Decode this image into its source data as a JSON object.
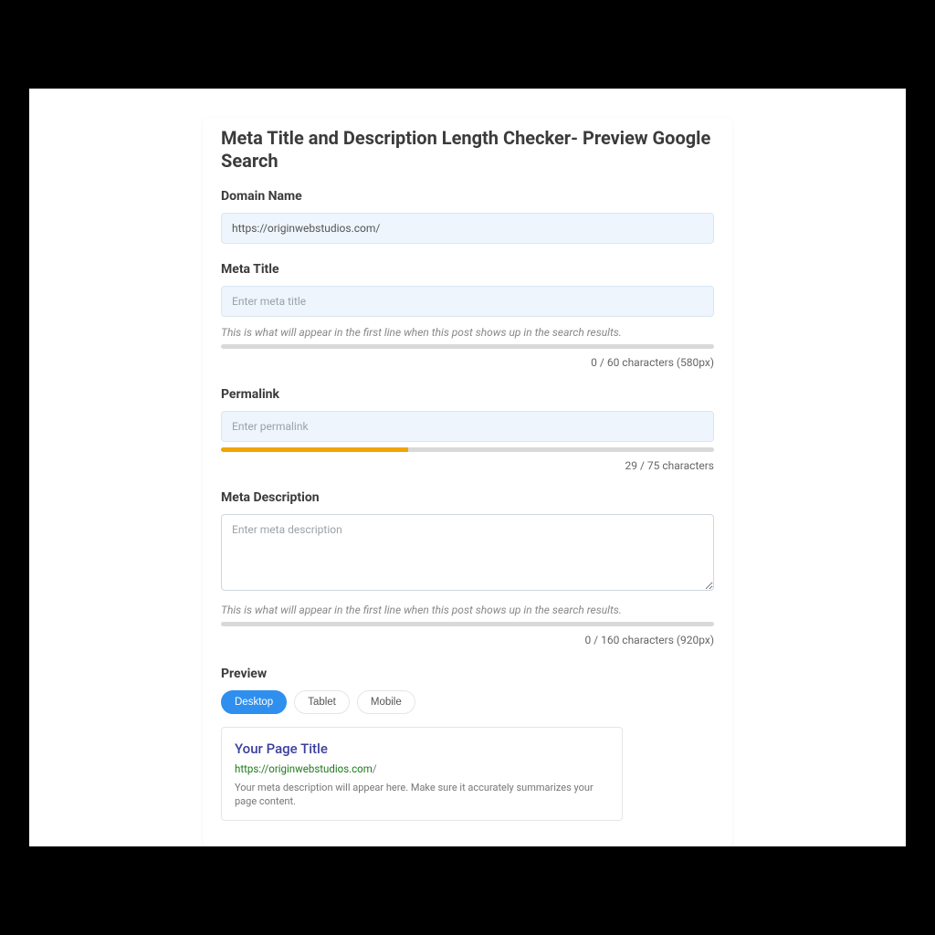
{
  "title": "Meta Title and Description Length Checker- Preview Google Search",
  "domain": {
    "label": "Domain Name",
    "value": "https://originwebstudios.com/"
  },
  "metaTitle": {
    "label": "Meta Title",
    "placeholder": "Enter meta title",
    "helper": "This is what will appear in the first line when this post shows up in the search results.",
    "counter": "0 / 60 characters (580px)",
    "fillPercent": 0
  },
  "permalink": {
    "label": "Permalink",
    "placeholder": "Enter permalink",
    "counter": "29 / 75 characters",
    "fillPercent": 38
  },
  "metaDesc": {
    "label": "Meta Description",
    "placeholder": "Enter meta description",
    "helper": "This is what will appear in the first line when this post shows up in the search results.",
    "counter": "0 / 160 characters (920px)",
    "fillPercent": 0
  },
  "preview": {
    "label": "Preview",
    "tabs": [
      "Desktop",
      "Tablet",
      "Mobile"
    ],
    "activeTab": 0,
    "title": "Your Page Title",
    "urlGreen": "https://originwebstudios.com",
    "urlGrey": "/",
    "desc": "Your meta description will appear here. Make sure it accurately summarizes your page content."
  }
}
